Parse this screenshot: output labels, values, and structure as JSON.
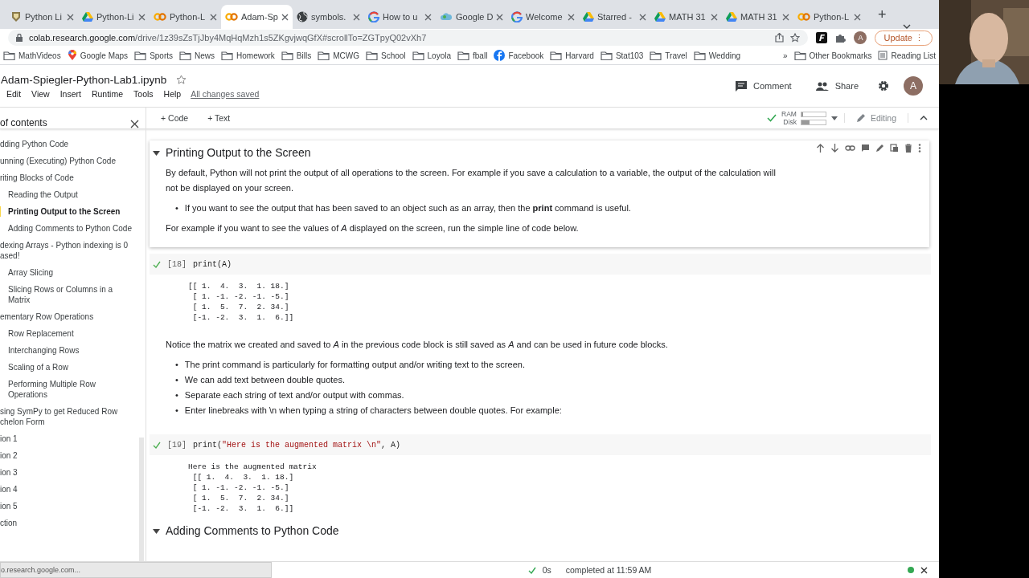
{
  "browser": {
    "tabs": [
      {
        "title": "Python Li",
        "kind": "shield",
        "selected": false
      },
      {
        "title": "Python-Li",
        "kind": "drive",
        "selected": false
      },
      {
        "title": "Python-L",
        "kind": "colab",
        "selected": false
      },
      {
        "title": "Adam-Sp",
        "kind": "colab",
        "selected": true
      },
      {
        "title": "symbols.",
        "kind": "globe",
        "selected": false
      },
      {
        "title": "How to u",
        "kind": "google",
        "selected": false
      },
      {
        "title": "Google D",
        "kind": "cloud",
        "selected": false
      },
      {
        "title": "Welcome",
        "kind": "google",
        "selected": false
      },
      {
        "title": "Starred -",
        "kind": "drive",
        "selected": false
      },
      {
        "title": "MATH 31",
        "kind": "drive",
        "selected": false
      },
      {
        "title": "MATH 31",
        "kind": "drive",
        "selected": false
      },
      {
        "title": "Python-L",
        "kind": "colab",
        "selected": false
      }
    ],
    "new_tab": "+",
    "url": {
      "host": "colab.research.google.com",
      "path": "/drive/1z39sZsTjJby4MqHqMzh1s5ZKgvjwqGfX#scrollTo=ZGTpyQ02vXh7"
    },
    "profile": "A",
    "update": "Update",
    "update_menu": "⋮",
    "bookmarks": [
      {
        "label": "MathVideos",
        "kind": "folder"
      },
      {
        "label": "Google Maps",
        "kind": "pin"
      },
      {
        "label": "Sports",
        "kind": "folder"
      },
      {
        "label": "News",
        "kind": "folder"
      },
      {
        "label": "Homework",
        "kind": "folder"
      },
      {
        "label": "Bills",
        "kind": "folder"
      },
      {
        "label": "MCWG",
        "kind": "folder"
      },
      {
        "label": "School",
        "kind": "folder"
      },
      {
        "label": "Loyola",
        "kind": "folder"
      },
      {
        "label": "fball",
        "kind": "folder"
      },
      {
        "label": "Facebook",
        "kind": "facebook"
      },
      {
        "label": "Harvard",
        "kind": "folder"
      },
      {
        "label": "Stat103",
        "kind": "folder"
      },
      {
        "label": "Travel",
        "kind": "folder"
      },
      {
        "label": "Wedding",
        "kind": "folder"
      }
    ],
    "more": "»",
    "other_bookmarks": "Other Bookmarks",
    "reading_list": "Reading List"
  },
  "notebook": {
    "title": "Adam-Spiegler-Python-Lab1.ipynb",
    "menu": [
      "Edit",
      "View",
      "Insert",
      "Runtime",
      "Tools",
      "Help"
    ],
    "save_status": "All changes saved",
    "comment": "Comment",
    "share": "Share",
    "avatar": "A"
  },
  "toolbar": {
    "add_code": "+ Code",
    "add_text": "+ Text",
    "ram": {
      "label": "RAM",
      "level": 0.06
    },
    "disk": {
      "label": "Disk",
      "level": 0.35
    },
    "mode": "Editing"
  },
  "sidebar": {
    "title": "of contents",
    "items": [
      {
        "title": "dding Python Code",
        "selected": false
      },
      {
        "title": "unning (Executing) Python Code",
        "selected": false
      },
      {
        "title": "riting Blocks of Code",
        "selected": false,
        "children": [
          {
            "title": "Reading the Output",
            "selected": false
          },
          {
            "title": "Printing Output to the Screen",
            "selected": true
          },
          {
            "title": "Adding Comments to Python Code",
            "selected": false
          }
        ]
      },
      {
        "title": "dexing Arrays - Python indexing is 0 ased!",
        "selected": false,
        "children": [
          {
            "title": "Array Slicing",
            "selected": false
          },
          {
            "title": "Slicing Rows or Columns in a Matrix",
            "selected": false
          }
        ]
      },
      {
        "title": "ementary Row Operations",
        "selected": false,
        "children": [
          {
            "title": "Row Replacement",
            "selected": false
          },
          {
            "title": "Interchanging Rows",
            "selected": false
          },
          {
            "title": "Scaling of a Row",
            "selected": false
          },
          {
            "title": "Performing Multiple Row Operations",
            "selected": false
          }
        ]
      },
      {
        "title": "sing SymPy to get Reduced Row chelon Form",
        "selected": false
      },
      {
        "title": "ion 1",
        "selected": false
      },
      {
        "title": "ion 2",
        "selected": false
      },
      {
        "title": "ion 3",
        "selected": false
      },
      {
        "title": "ion 4",
        "selected": false
      },
      {
        "title": "ion 5",
        "selected": false
      },
      {
        "title": "ction",
        "selected": false
      }
    ],
    "link_preview": "o.research.google.com..."
  },
  "cells": [
    {
      "kind": "text",
      "focused": true,
      "blocks": [
        {
          "kind": "heading",
          "text": "Printing Output to the Screen"
        },
        {
          "kind": "para",
          "text": "By default, Python will not print the output of all operations to the screen. For example if you save a calculation to a variable, the output of the calculation will not be displayed on your screen."
        },
        {
          "kind": "bullets",
          "marker": "•",
          "items": [
            "If you want to see the output that has been saved to an object such as an array, then the **print** command is useful."
          ]
        },
        {
          "kind": "para",
          "text": "For example if you want to see the values of *A* displayed on the screen, run the simple line of code below."
        }
      ]
    },
    {
      "kind": "code",
      "count": "[18]",
      "code": [
        {
          "kind": "plain",
          "text": "print(A)"
        }
      ],
      "output": "[[ 1.  4.  3.  1. 18.]\n [ 1. -1. -2. -1. -5.]\n [ 1.  5.  7.  2. 34.]\n [-1. -2.  3.  1.  6.]]"
    },
    {
      "kind": "text",
      "blocks": [
        {
          "kind": "para",
          "text": "Notice the matrix we created and saved to *A* in the previous code block is still saved as *A* and can be used in future code blocks."
        },
        {
          "kind": "bullets",
          "marker": "•",
          "items": [
            "The print command is particularly for formatting output and/or writing text to the screen.",
            "We can add text between double quotes.",
            "Separate each string of text and/or output with commas.",
            "Enter linebreaks with \\n when typing a string of characters between double quotes. For example:"
          ]
        }
      ]
    },
    {
      "kind": "code",
      "count": "[19]",
      "code": [
        {
          "kind": "plain",
          "text": "print("
        },
        {
          "kind": "string",
          "text": "\"Here is the augmented matrix \\n\""
        },
        {
          "kind": "plain",
          "text": ", A)"
        }
      ],
      "output": "Here is the augmented matrix\n [[ 1.  4.  3.  1. 18.]\n [ 1. -1. -2. -1. -5.]\n [ 1.  5.  7.  2. 34.]\n [-1. -2.  3.  1.  6.]]"
    },
    {
      "kind": "text",
      "blocks": [
        {
          "kind": "heading",
          "text": "Adding Comments to Python Code"
        }
      ]
    }
  ],
  "status_bar": {
    "duration": "0s",
    "message": "completed at 11:59 AM"
  }
}
